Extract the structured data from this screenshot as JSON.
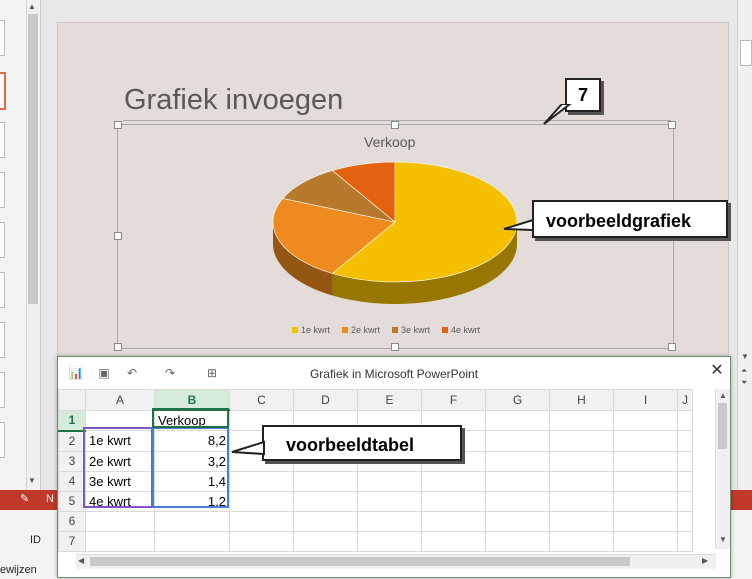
{
  "slide": {
    "title": "Grafiek invoegen"
  },
  "chart_data": {
    "type": "pie",
    "title": "Verkoop",
    "categories": [
      "1e kwrt",
      "2e kwrt",
      "3e kwrt",
      "4e kwrt"
    ],
    "values": [
      8.2,
      3.2,
      1.4,
      1.2
    ],
    "colors": [
      "#f5c000",
      "#ef8a1f",
      "#b77a2c",
      "#e2620f"
    ],
    "legend_position": "bottom"
  },
  "callouts": {
    "number": "7",
    "chart": "voorbeeldgrafiek",
    "table": "voorbeeldtabel"
  },
  "spreadsheet": {
    "window_title": "Grafiek in Microsoft PowerPoint",
    "close_glyph": "✕",
    "columns": [
      "A",
      "B",
      "C",
      "D",
      "E",
      "F",
      "G",
      "H",
      "I",
      "J"
    ],
    "rows": [
      {
        "n": "1",
        "a": "",
        "b": "Verkoop"
      },
      {
        "n": "2",
        "a": "1e kwrt",
        "b": "8,2"
      },
      {
        "n": "3",
        "a": "2e kwrt",
        "b": "3,2"
      },
      {
        "n": "4",
        "a": "3e kwrt",
        "b": "1,4"
      },
      {
        "n": "5",
        "a": "4e kwrt",
        "b": "1,2"
      },
      {
        "n": "6",
        "a": "",
        "b": ""
      },
      {
        "n": "7",
        "a": "",
        "b": ""
      }
    ]
  },
  "statusbar": {
    "left_text": "N",
    "id_label": "ID",
    "bottom_text": "ewijzen"
  }
}
